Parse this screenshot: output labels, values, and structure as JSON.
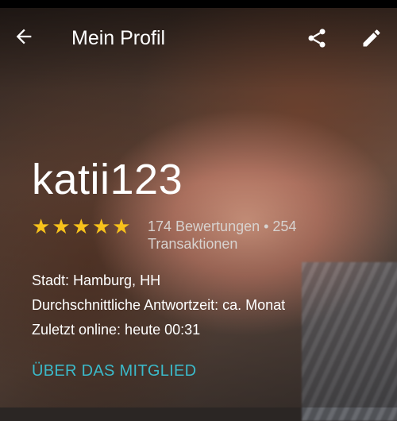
{
  "header": {
    "title": "Mein Profil",
    "back_icon": "arrow-left-icon",
    "share_icon": "share-icon",
    "edit_icon": "pencil-icon"
  },
  "profile": {
    "username": "katii123",
    "rating": {
      "stars": 5,
      "max": 5
    },
    "ratings_text": "174 Bewertungen • 254 Transaktionen",
    "city": "Stadt:  Hamburg, HH",
    "response_time": "Durchschnittliche Antwortzeit:  ca. Monat",
    "last_online": "Zuletzt online: heute 00:31"
  },
  "actions": {
    "about_member": "ÜBER DAS MITGLIED"
  },
  "colors": {
    "star": "#f7c21b",
    "accent": "#3bb9c9",
    "text": "#ffffff"
  }
}
